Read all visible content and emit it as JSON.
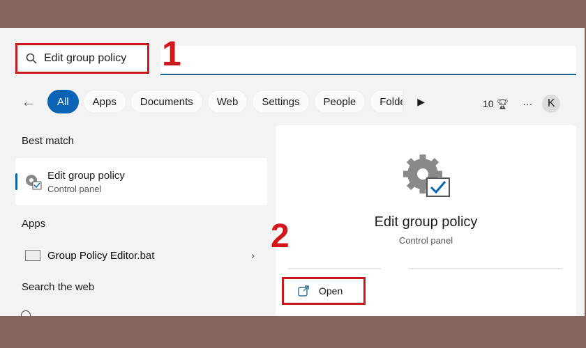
{
  "search": {
    "query": "Edit group policy",
    "icon": "search-icon"
  },
  "callouts": [
    "1",
    "2"
  ],
  "tabs": [
    {
      "label": "All"
    },
    {
      "label": "Apps"
    },
    {
      "label": "Documents"
    },
    {
      "label": "Web"
    },
    {
      "label": "Settings"
    },
    {
      "label": "People"
    },
    {
      "label": "Folde"
    }
  ],
  "toolbar": {
    "points": "10",
    "more": "···",
    "avatar": "K"
  },
  "left": {
    "best_match_label": "Best match",
    "best_match": {
      "title": "Edit group policy",
      "subtitle": "Control panel"
    },
    "apps_label": "Apps",
    "app_item": {
      "title_bold": "Group Policy Edit",
      "title_rest": "or.bat"
    },
    "web_label": "Search the web"
  },
  "detail": {
    "title": "Edit group policy",
    "subtitle": "Control panel",
    "open_label": "Open"
  },
  "colors": {
    "accent": "#0a63b5",
    "highlight": "#c8191f",
    "frame": "#85655d"
  }
}
